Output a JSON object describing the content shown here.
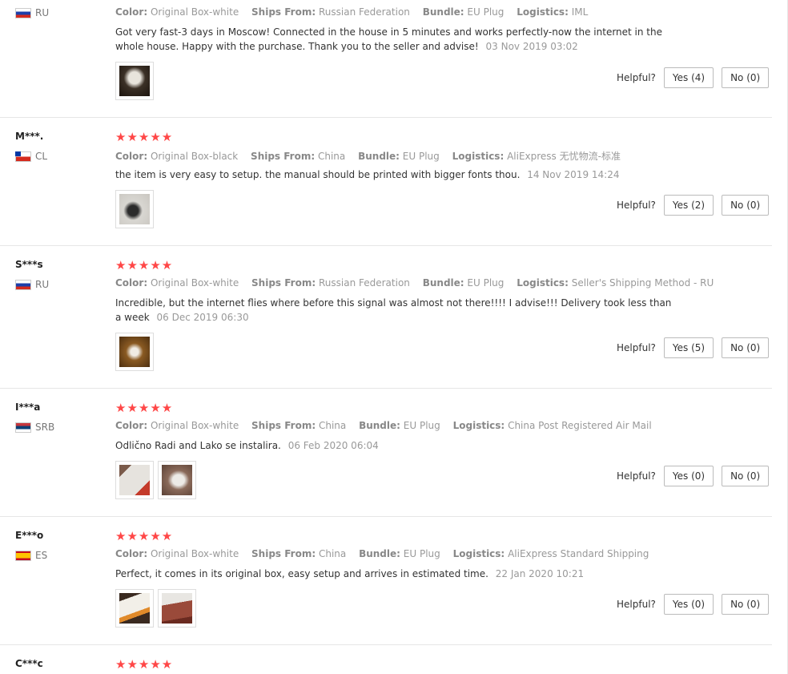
{
  "labels": {
    "color": "Color:",
    "ships_from": "Ships From:",
    "bundle": "Bundle:",
    "logistics": "Logistics:",
    "helpful": "Helpful?"
  },
  "colors": {
    "star": "#ff4747",
    "divider": "#e6e6e6"
  },
  "reviews": [
    {
      "user": "",
      "country": "RU",
      "flag": "flag-russia-icon",
      "stars": "",
      "color": "Original Box-white",
      "ships_from": "Russian Federation",
      "bundle": "EU Plug",
      "logistics": "IML",
      "text": "Got very fast-3 days in Moscow! Connected in the house in 5 minutes and works perfectly-now the internet in the whole house. Happy with the purchase. Thank you to the seller and advise!",
      "date": "03 Nov 2019 03:02",
      "yes": "Yes (4)",
      "no": "No (0)"
    },
    {
      "user": "M***.",
      "country": "CL",
      "flag": "flag-chile-icon",
      "stars": "★★★★★",
      "color": "Original Box-black",
      "ships_from": "China",
      "bundle": "EU Plug",
      "logistics": "AliExpress 无忧物流-标准",
      "text": "the item is very easy to setup. the manual should be printed with bigger fonts thou.",
      "date": "14 Nov 2019 14:24",
      "yes": "Yes (2)",
      "no": "No (0)"
    },
    {
      "user": "S***s",
      "country": "RU",
      "flag": "flag-russia-icon",
      "stars": "★★★★★",
      "color": "Original Box-white",
      "ships_from": "Russian Federation",
      "bundle": "EU Plug",
      "logistics": "Seller's Shipping Method - RU",
      "text": "Incredible, but the internet flies where before this signal was almost not there!!!! I advise!!! Delivery took less than a week",
      "date": "06 Dec 2019 06:30",
      "yes": "Yes (5)",
      "no": "No (0)"
    },
    {
      "user": "I***a",
      "country": "SRB",
      "flag": "flag-serbia-icon",
      "stars": "★★★★★",
      "color": "Original Box-white",
      "ships_from": "China",
      "bundle": "EU Plug",
      "logistics": "China Post Registered Air Mail",
      "text": "Odlično Radi and Lako se instalira.",
      "date": "06 Feb 2020 06:04",
      "yes": "Yes (0)",
      "no": "No (0)"
    },
    {
      "user": "E***o",
      "country": "ES",
      "flag": "flag-spain-icon",
      "stars": "★★★★★",
      "color": "Original Box-white",
      "ships_from": "China",
      "bundle": "EU Plug",
      "logistics": "AliExpress Standard Shipping",
      "text": "Perfect, it comes in its original box, easy setup and arrives in estimated time.",
      "date": "22 Jan 2020 10:21",
      "yes": "Yes (0)",
      "no": "No (0)"
    },
    {
      "user": "C***c",
      "stars": "★★★★★"
    }
  ]
}
